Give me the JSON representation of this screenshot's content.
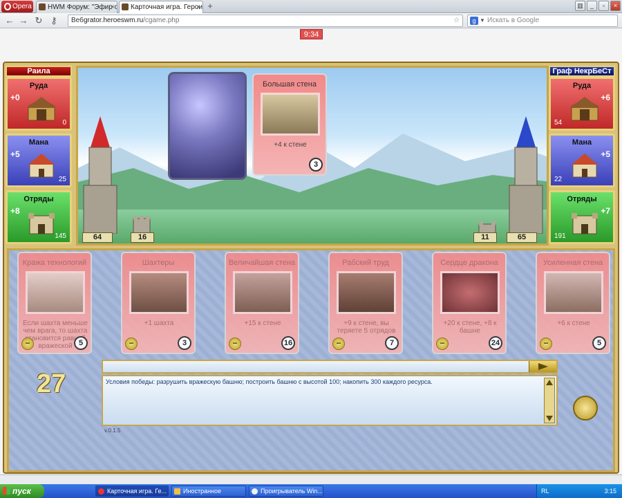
{
  "browser": {
    "menu_label": "Opera",
    "tabs": [
      {
        "label": "HWM Форум: \"Эфир от ..."
      },
      {
        "label": "Карточная игра. Герои..."
      }
    ],
    "address": {
      "prefix": "Веб",
      "host": "grator.heroeswm.ru",
      "path": "/cgame.php"
    },
    "search_placeholder": "Искать в Google"
  },
  "game": {
    "timer": "9:34",
    "turn": "27",
    "left_player": {
      "name": "Раила",
      "ore": {
        "label": "Руда",
        "income": "+0",
        "amount": "0"
      },
      "mana": {
        "label": "Мана",
        "income": "+5",
        "amount": "25"
      },
      "army": {
        "label": "Отряды",
        "income": "+8",
        "amount": "145"
      },
      "tower": "64",
      "wall": "16"
    },
    "right_player": {
      "name": "Граф НекрБеСт",
      "ore": {
        "label": "Руда",
        "income": "+6",
        "amount": "54"
      },
      "mana": {
        "label": "Мана",
        "income": "+5",
        "amount": "22"
      },
      "army": {
        "label": "Отряды",
        "income": "+7",
        "amount": "191"
      },
      "tower": "65",
      "wall": "11"
    },
    "played_card": {
      "title": "Большая стена",
      "desc": "+4 к стене",
      "cost": "3"
    },
    "hand": [
      {
        "title": "Кража технологий",
        "desc": "Если шахта меньше чем врага, то шахта становится равной вражеской",
        "cost": "5"
      },
      {
        "title": "Шахтеры",
        "desc": "+1 шахта",
        "cost": "3"
      },
      {
        "title": "Величайшая стена",
        "desc": "+15 к стене",
        "cost": "16"
      },
      {
        "title": "Рабский труд",
        "desc": "+9 к стене, вы теряете 5 отрядов",
        "cost": "7"
      },
      {
        "title": "Сердце дракона",
        "desc": "+20 к стене, +8 к башне",
        "cost": "24"
      },
      {
        "title": "Усиленная стена",
        "desc": "+6 к стене",
        "cost": "5"
      }
    ],
    "minus_symbol": "−",
    "log_text": "Условия победы: разрушить вражескую башню; построить башню с высотой 100; накопить 300 каждого ресурса.",
    "version": "v.0.1.5"
  },
  "taskbar": {
    "start_label": "пуск",
    "items": [
      {
        "label": "Карточная игра. Ге..."
      },
      {
        "label": "Иностранное"
      },
      {
        "label": "Проигрыватель Win..."
      }
    ],
    "lang": "RL",
    "clock": "3:15"
  },
  "colors": {
    "ore": "#d23a3a",
    "mana": "#4a52c8",
    "army": "#3aaa3a",
    "frame": "#c7a646"
  }
}
